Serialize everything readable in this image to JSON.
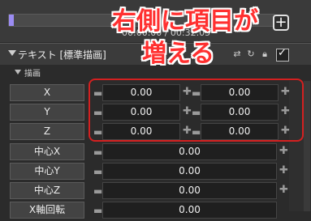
{
  "timeline": {
    "time_readout": "00:00.00 / 00:32.05",
    "progress": 0.02
  },
  "layer": {
    "title": "テキスト [標準描画]",
    "enabled": true
  },
  "group": {
    "label": "描画"
  },
  "params": [
    {
      "label": "X",
      "value": "0.00",
      "value2": "0.00"
    },
    {
      "label": "Y",
      "value": "0.00",
      "value2": "0.00"
    },
    {
      "label": "Z",
      "value": "0.00",
      "value2": "0.00"
    },
    {
      "label": "中心X",
      "value": "0.00"
    },
    {
      "label": "中心Y",
      "value": "0.00"
    },
    {
      "label": "中心Z",
      "value": "0.00"
    },
    {
      "label": "X軸回転",
      "value": "0.00"
    }
  ],
  "annotation": {
    "line1": "右側に項目が",
    "line2": "増える"
  },
  "colors": {
    "accent": "#9b8cf2",
    "annotation_red": "#d42020"
  },
  "icons": {
    "add": "plus-icon",
    "reset": "reset-icon",
    "lock": "lock-icon",
    "link": "link-icon"
  }
}
